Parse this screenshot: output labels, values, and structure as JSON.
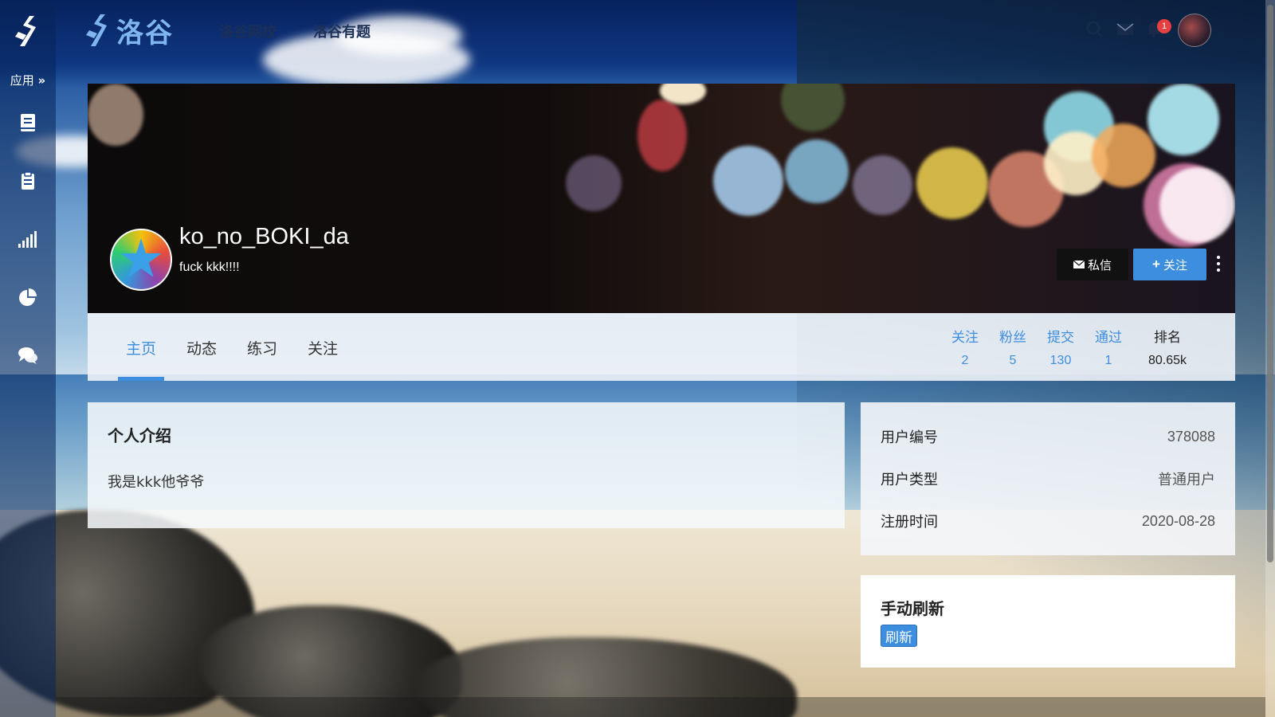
{
  "sidebar": {
    "apps_label": "应用",
    "icons": [
      "book-icon",
      "clipboard-icon",
      "signal-bars-icon",
      "pie-chart-icon",
      "chat-bubbles-icon"
    ]
  },
  "topbar": {
    "brand": "洛谷",
    "nav": [
      "洛谷网校",
      "洛谷有题"
    ],
    "notification_count": "1"
  },
  "profile": {
    "username": "ko_no_BOKI_da",
    "slogan": "fuck kkk!!!!",
    "message_button": "私信",
    "follow_button": "关注"
  },
  "tabs": [
    "主页",
    "动态",
    "练习",
    "关注"
  ],
  "active_tab": "主页",
  "stats": [
    {
      "label": "关注",
      "value": "2"
    },
    {
      "label": "粉丝",
      "value": "5"
    },
    {
      "label": "提交",
      "value": "130"
    },
    {
      "label": "通过",
      "value": "1"
    },
    {
      "label": "排名",
      "value": "80.65k"
    }
  ],
  "intro": {
    "title": "个人介绍",
    "text": "我是kkk他爷爷"
  },
  "info": [
    {
      "key": "用户编号",
      "value": "378088"
    },
    {
      "key": "用户类型",
      "value": "普通用户"
    },
    {
      "key": "注册时间",
      "value": "2020-08-28"
    }
  ],
  "refresh": {
    "title": "手动刷新",
    "button": "刷新"
  },
  "colors": {
    "accent": "#3e8ee0",
    "dark_button": "#111111",
    "badge": "#e64040"
  }
}
